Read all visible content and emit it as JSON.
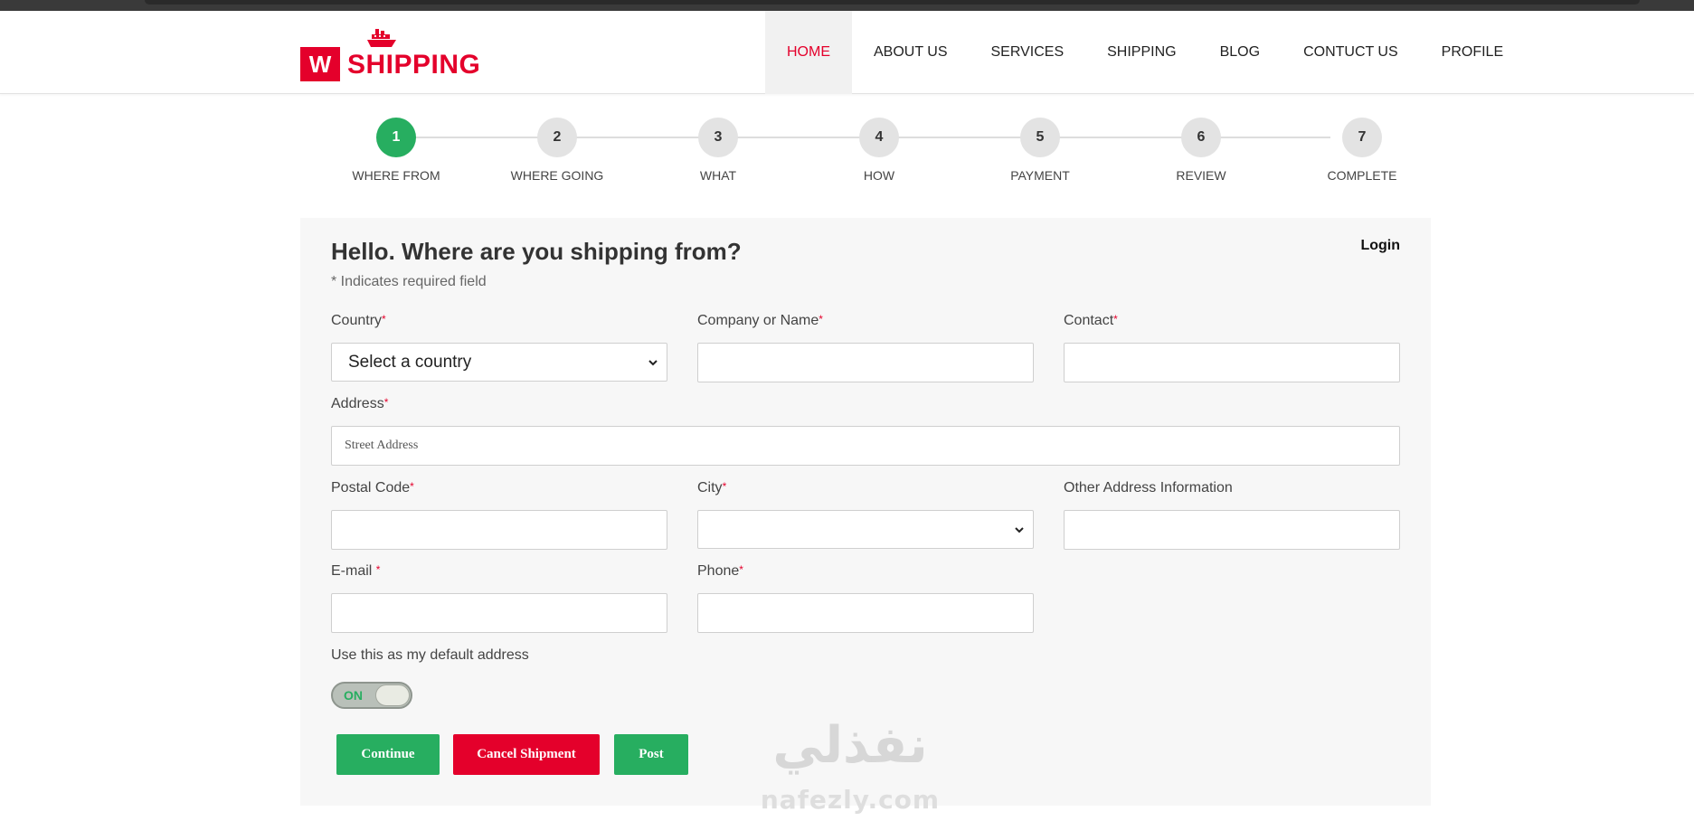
{
  "brand": {
    "badge": "W",
    "name": "SHIPPING",
    "accent_color": "#e4002b"
  },
  "nav": {
    "items": [
      {
        "label": "HOME",
        "active": true
      },
      {
        "label": "ABOUT US"
      },
      {
        "label": "SERVICES"
      },
      {
        "label": "SHIPPING"
      },
      {
        "label": "BLOG"
      },
      {
        "label": "CONTUCT US"
      },
      {
        "label": "PROFILE"
      }
    ]
  },
  "steps": [
    {
      "number": "1",
      "label": "WHERE FROM",
      "active": true
    },
    {
      "number": "2",
      "label": "WHERE GOING"
    },
    {
      "number": "3",
      "label": "WHAT"
    },
    {
      "number": "4",
      "label": "HOW"
    },
    {
      "number": "5",
      "label": "PAYMENT"
    },
    {
      "number": "6",
      "label": "REVIEW"
    },
    {
      "number": "7",
      "label": "COMPLETE"
    }
  ],
  "form": {
    "title": "Hello. Where are you shipping from?",
    "required_note": "* Indicates required field",
    "login_label": "Login",
    "required_mark": "*",
    "country": {
      "label": "Country",
      "selected": "Select a country"
    },
    "company": {
      "label": "Company or Name",
      "value": ""
    },
    "contact": {
      "label": "Contact",
      "value": ""
    },
    "address": {
      "label": "Address",
      "placeholder": "Street Address"
    },
    "postal": {
      "label": "Postal Code",
      "value": ""
    },
    "city": {
      "label": "City",
      "selected": ""
    },
    "other_address": {
      "label": "Other Address Information",
      "value": ""
    },
    "email": {
      "label": "E-mail ",
      "value": ""
    },
    "phone": {
      "label": "Phone",
      "value": ""
    },
    "default_address": {
      "label": "Use this as my default address",
      "toggle_text": "ON",
      "on": true
    },
    "buttons": {
      "continue": "Continue",
      "cancel": "Cancel Shipment",
      "post": "Post"
    }
  },
  "watermark": {
    "arabic": "نفذلي",
    "latin": "nafezly.com"
  },
  "colors": {
    "success": "#27ae60",
    "danger": "#e4002b",
    "panel_bg": "#f7f7f7"
  }
}
